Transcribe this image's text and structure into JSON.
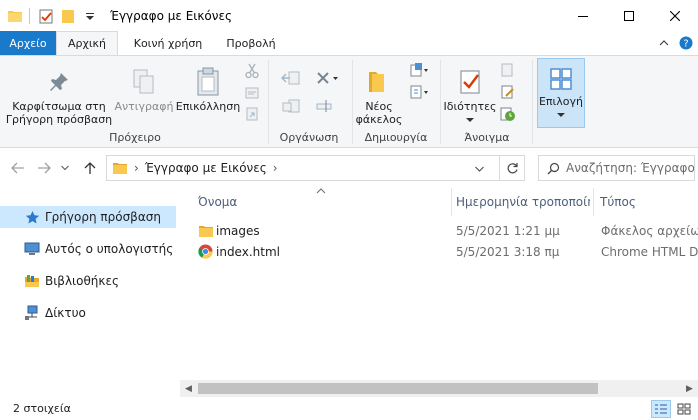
{
  "window": {
    "title": "Έγγραφο με Εικόνες"
  },
  "ribbon_tabs": {
    "file": "Αρχείο",
    "home": "Αρχική",
    "share": "Κοινή χρήση",
    "view": "Προβολή"
  },
  "ribbon": {
    "pin": "Καρφίτσωμα στη",
    "pin_line2": "Γρήγορη πρόσβαση",
    "copy": "Αντιγραφή",
    "paste": "Επικόλληση",
    "clipboard_group": "Πρόχειρο",
    "organize_group": "Οργάνωση",
    "new_folder": "Νέος",
    "new_folder_line2": "φάκελος",
    "new_group": "Δημιουργία",
    "properties": "Ιδιότητες",
    "open_group": "Άνοιγμα",
    "select": "Επιλογή"
  },
  "address": {
    "path": "Έγγραφο με Εικόνες",
    "search_placeholder": "Αναζήτηση: Έγγραφο με Εικόνες"
  },
  "nav_pane": {
    "items": [
      {
        "label": "Γρήγορη πρόσβαση",
        "icon": "star-icon",
        "selected": true
      },
      {
        "label": "Αυτός ο υπολογιστής",
        "icon": "computer-icon"
      },
      {
        "label": "Βιβλιοθήκες",
        "icon": "library-icon"
      },
      {
        "label": "Δίκτυο",
        "icon": "network-icon"
      }
    ]
  },
  "file_list": {
    "columns": {
      "name": "Όνομα",
      "date": "Ημερομηνία τροποποίησης",
      "type": "Τύπος"
    },
    "rows": [
      {
        "name": "images",
        "date": "5/5/2021 1:21 μμ",
        "type": "Φάκελος αρχείων",
        "icon": "folder-icon"
      },
      {
        "name": "index.html",
        "date": "5/5/2021 3:18 πμ",
        "type": "Chrome HTML Document",
        "icon": "chrome-icon"
      }
    ]
  },
  "status": {
    "item_count": "2 στοιχεία"
  },
  "colors": {
    "accent": "#1979ca",
    "folder": "#f8c94e",
    "selection": "#cce8ff"
  }
}
